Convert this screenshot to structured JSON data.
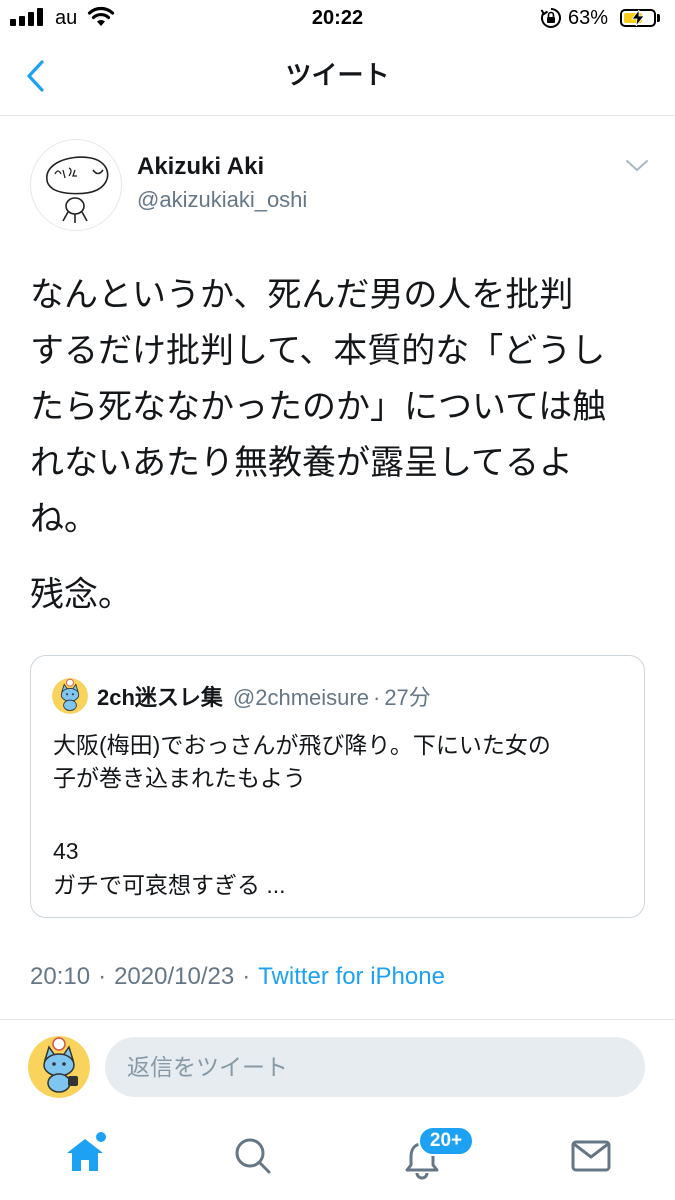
{
  "status_bar": {
    "carrier": "au",
    "time": "20:22",
    "battery_percent": "63%",
    "battery_level": 0.63,
    "charging": true,
    "icons": [
      "signal-icon",
      "wifi-icon",
      "rotation-lock-icon",
      "battery-icon"
    ]
  },
  "header": {
    "title": "ツイート",
    "back_icon": "chevron-left-icon"
  },
  "tweet": {
    "author": {
      "name": "Akizuki Aki",
      "handle": "@akizukiaki_oshi"
    },
    "menu_icon": "chevron-down-icon",
    "text_lines": [
      "なんというか、死んだ男の人を批判",
      "するだけ批判して、本質的な「どうし",
      "たら死ななかったのか」については触",
      "れないあたり無教養が露呈してるよ",
      "ね。"
    ],
    "text_2": "残念。",
    "quote": {
      "author_name": "2ch迷スレ集",
      "author_handle": "@2chmeisure",
      "separator": "·",
      "age": "27分",
      "body_lines": [
        "大阪(梅田)でおっさんが飛び降り。下にいた女の",
        "子が巻き込まれたもよう"
      ],
      "body_lines_2": [
        "43",
        "ガチで可哀想すぎる ..."
      ]
    },
    "meta": {
      "time": "20:10",
      "separator": "·",
      "date": "2020/10/23",
      "source": "Twitter for iPhone"
    }
  },
  "reply": {
    "placeholder": "返信をツイート"
  },
  "tab_bar": {
    "items": [
      {
        "icon": "home-icon",
        "active": true,
        "dot": true
      },
      {
        "icon": "search-icon",
        "active": false
      },
      {
        "icon": "bell-icon",
        "active": false,
        "badge": "20+"
      },
      {
        "icon": "envelope-icon",
        "active": false
      }
    ]
  },
  "colors": {
    "accent": "#1da1f2",
    "text": "#14171a",
    "secondary_text": "#657786",
    "border": "#ccd6dd",
    "input_bg": "#e6ecf0",
    "battery_fill": "#f7cf1b"
  }
}
